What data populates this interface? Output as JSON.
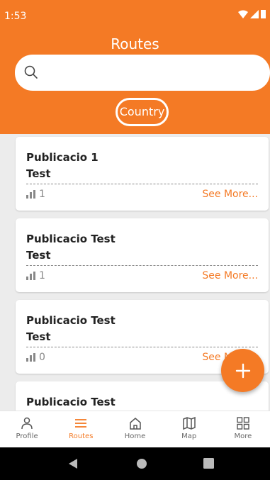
{
  "status_bar": {
    "time": "1:53"
  },
  "header": {
    "title": "Routes",
    "search": {
      "placeholder": "",
      "value": ""
    },
    "filter_chip": "Country"
  },
  "routes": [
    {
      "title": "Publicacio 1",
      "subtitle": "Test",
      "count": "1",
      "action": "See More..."
    },
    {
      "title": "Publicacio Test",
      "subtitle": "Test",
      "count": "1",
      "action": "See More..."
    },
    {
      "title": "Publicacio Test",
      "subtitle": "Test",
      "count": "0",
      "action": "See More..."
    },
    {
      "title": "Publicacio Test",
      "subtitle": "",
      "count": "",
      "action": ""
    }
  ],
  "fab": {
    "icon": "plus-icon"
  },
  "bottom_nav": [
    {
      "label": "Profile",
      "icon": "person-icon",
      "active": false
    },
    {
      "label": "Routes",
      "icon": "menu-icon",
      "active": true
    },
    {
      "label": "Home",
      "icon": "home-icon",
      "active": false
    },
    {
      "label": "Map",
      "icon": "map-icon",
      "active": false
    },
    {
      "label": "More",
      "icon": "grid-icon",
      "active": false
    }
  ],
  "colors": {
    "accent": "#f47a25",
    "background": "#ececec",
    "card": "#ffffff"
  }
}
